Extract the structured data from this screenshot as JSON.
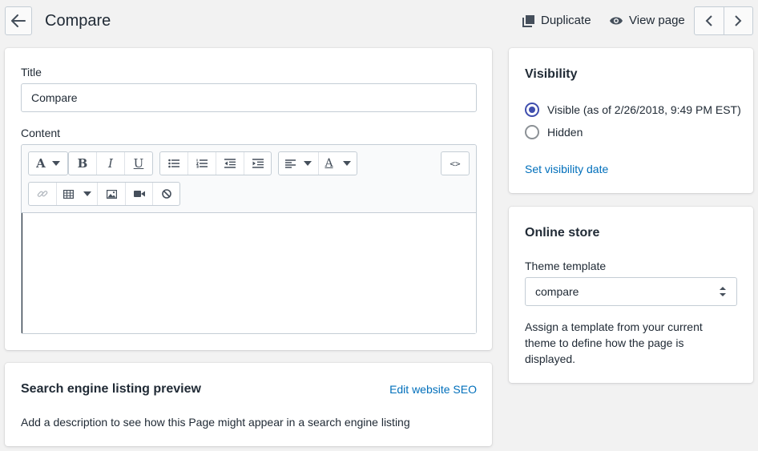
{
  "header": {
    "title": "Compare",
    "duplicate_label": "Duplicate",
    "view_page_label": "View page"
  },
  "main": {
    "title_label": "Title",
    "title_value": "Compare",
    "content_label": "Content",
    "toolbar": {
      "row1": [
        "font-icon",
        "bold-icon",
        "italic-icon",
        "underline-icon",
        "bullet-list-icon",
        "numbered-list-icon",
        "outdent-icon",
        "indent-icon",
        "align-icon",
        "text-color-icon",
        "code-view-icon"
      ],
      "row2": [
        "link-icon",
        "table-icon",
        "image-icon",
        "video-icon",
        "clear-format-icon"
      ],
      "glyphs": {
        "font": "A",
        "bold": "B",
        "italic": "I",
        "underline": "U",
        "text_color": "A",
        "code": "<>"
      }
    }
  },
  "seo": {
    "heading": "Search engine listing preview",
    "edit_link": "Edit website SEO",
    "description": "Add a description to see how this Page might appear in a search engine listing"
  },
  "visibility": {
    "heading": "Visibility",
    "options": [
      {
        "label": "Visible (as of 2/26/2018, 9:49 PM EST)",
        "selected": true
      },
      {
        "label": "Hidden",
        "selected": false
      }
    ],
    "set_date_link": "Set visibility date"
  },
  "online_store": {
    "heading": "Online store",
    "template_label": "Theme template",
    "template_value": "compare",
    "help_text": "Assign a template from your current theme to define how the page is displayed."
  },
  "colors": {
    "accent": "#3f4eae",
    "link": "#006fbb",
    "background": "#f2f2f2"
  }
}
